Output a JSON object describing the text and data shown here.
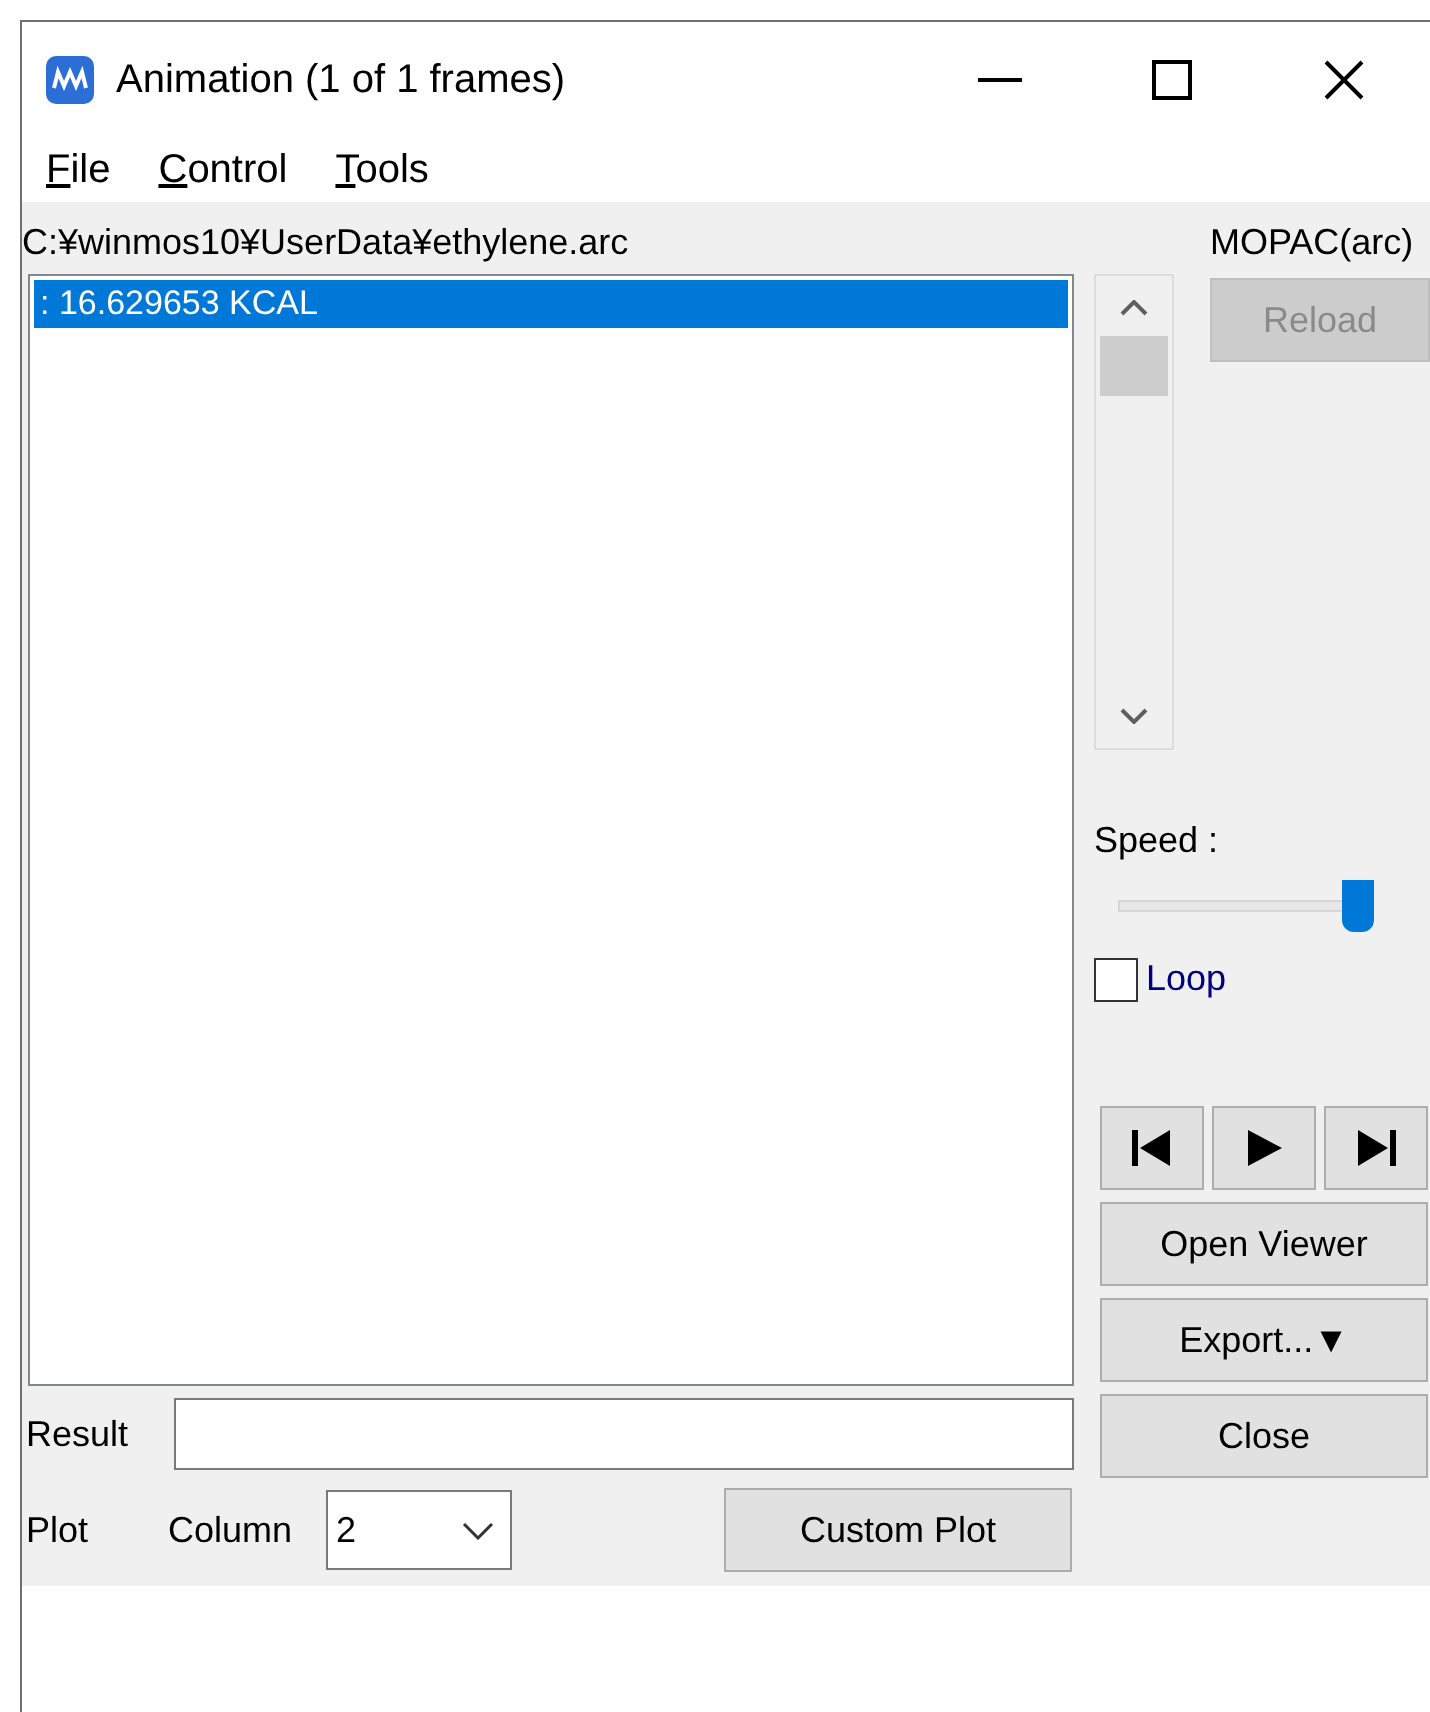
{
  "window": {
    "title": "Animation (1 of 1 frames)"
  },
  "menu": [
    {
      "label": "File"
    },
    {
      "label": "Control"
    },
    {
      "label": "Tools"
    }
  ],
  "file_path": "C:¥winmos10¥UserData¥ethylene.arc",
  "format_label": "MOPAC(arc)",
  "frames": [
    {
      "label": ": 16.629653 KCAL",
      "selected": true
    }
  ],
  "reload_button": {
    "label": "Reload",
    "disabled": true
  },
  "speed": {
    "label": "Speed :",
    "level": 0.95
  },
  "loop": {
    "label": "Loop",
    "checked": false
  },
  "playback_buttons": [
    {
      "kind": "first"
    },
    {
      "kind": "play"
    },
    {
      "kind": "last"
    }
  ],
  "buttons": [
    {
      "label": "Open Viewer"
    },
    {
      "label": "Export...▼"
    },
    {
      "label": "Close"
    }
  ],
  "result": {
    "label": "Result"
  },
  "plot": {
    "label": "Plot",
    "column_label": "Column",
    "column_value": "2",
    "button": "Custom Plot"
  }
}
